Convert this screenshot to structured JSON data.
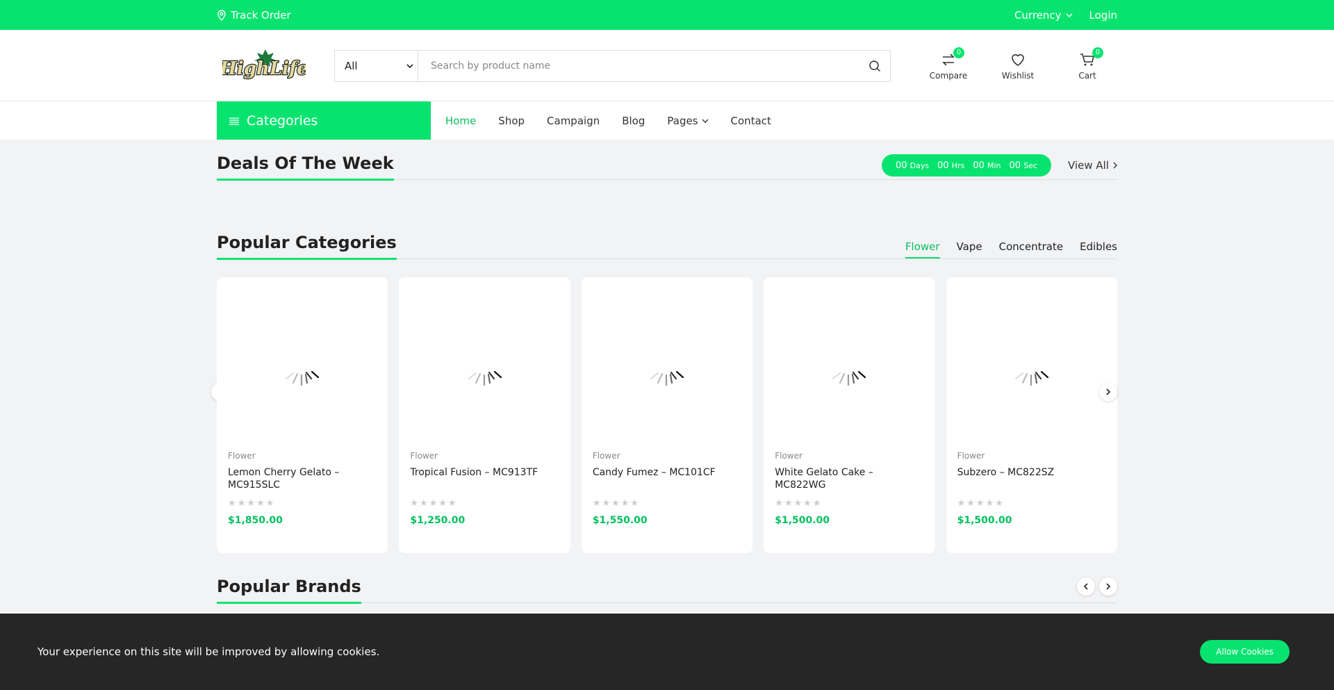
{
  "topbar": {
    "track_order": "Track Order",
    "currency": "Currency",
    "login": "Login"
  },
  "logo": {
    "text": "HighLife"
  },
  "search": {
    "category": "All",
    "placeholder": "Search by product name"
  },
  "header_icons": [
    {
      "label": "Compare",
      "count": "0",
      "icon": "compare-icon"
    },
    {
      "label": "Wishlist",
      "icon": "heart-icon"
    },
    {
      "label": "Cart",
      "count": "0",
      "icon": "cart-icon"
    }
  ],
  "nav": {
    "categories": "Categories",
    "items": [
      "Home",
      "Shop",
      "Campaign",
      "Blog",
      "Pages",
      "Contact"
    ]
  },
  "deals": {
    "title": "Deals Of The Week",
    "timer": {
      "days": "00",
      "days_label": "Days",
      "hrs": "00",
      "hrs_label": "Hrs",
      "min": "00",
      "min_label": "Min",
      "sec": "00",
      "sec_label": "Sec"
    },
    "view_all": "View All"
  },
  "popular": {
    "title": "Popular Categories",
    "tabs": [
      "Flower",
      "Vape",
      "Concentrate",
      "Edibles"
    ],
    "products": [
      {
        "category": "Flower",
        "name": "Lemon Cherry Gelato – MC915SLC",
        "price": "$1,850.00"
      },
      {
        "category": "Flower",
        "name": "Tropical Fusion – MC913TF",
        "price": "$1,250.00"
      },
      {
        "category": "Flower",
        "name": "Candy Fumez – MC101CF",
        "price": "$1,550.00"
      },
      {
        "category": "Flower",
        "name": "White Gelato Cake – MC822WG",
        "price": "$1,500.00"
      },
      {
        "category": "Flower",
        "name": "Subzero – MC822SZ",
        "price": "$1,500.00"
      }
    ]
  },
  "brands": {
    "title": "Popular Brands"
  },
  "cookie": {
    "text": "Your experience on this site will be improved by allowing cookies.",
    "button": "Allow Cookies"
  },
  "colors": {
    "accent": "#08e370",
    "price": "#08c060",
    "cookie_bg": "#262626"
  }
}
